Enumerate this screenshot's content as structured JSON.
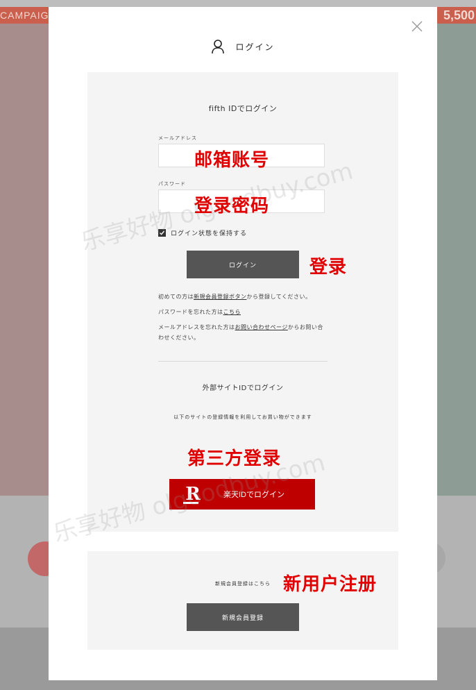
{
  "background": {
    "banner_left": "CAMPAIG",
    "banner_right": "5,500"
  },
  "modal": {
    "title": "ログイン",
    "icons": {
      "user": "user-icon",
      "close": "close-icon",
      "check": "check-icon",
      "rakuten": "rakuten-logo-icon"
    }
  },
  "fifth": {
    "title": "fifth IDでログイン",
    "email_label": "メールアドレス",
    "email_value": "",
    "password_label": "パスワード",
    "password_value": "",
    "keep_login": "ログイン状態を保持する",
    "login_button": "ログイン",
    "info1_pre": "初めての方は",
    "info1_link": "新規会員登録ボタン",
    "info1_post": "から登録してください。",
    "info2_pre": "パスワードを忘れた方は",
    "info2_link": "こちら",
    "info3_pre": "メールアドレスを忘れた方は",
    "info3_link": "お問い合わせページ",
    "info3_post": "からお問い合わせください。"
  },
  "external": {
    "title": "外部サイトIDでログイン",
    "subtitle": "以下のサイトの登録情報を利用してお買い物ができます",
    "rakuten_logo": "R",
    "rakuten_button": "楽天IDでログイン"
  },
  "register": {
    "text": "新規会員登録はこちら",
    "button": "新規会員登録"
  },
  "annotations": {
    "email": "邮箱账号",
    "password": "登录密码",
    "login": "登录",
    "third_party": "第三方登录",
    "new_user": "新用户注册"
  },
  "watermark": {
    "text1": "乐享好物 olgoodbuy.com",
    "text2": "乐享好物 olgoodbuy.com"
  },
  "colors": {
    "rakuten_red": "#bf0000",
    "annotation_red": "#e10000",
    "button_gray": "#555555"
  }
}
